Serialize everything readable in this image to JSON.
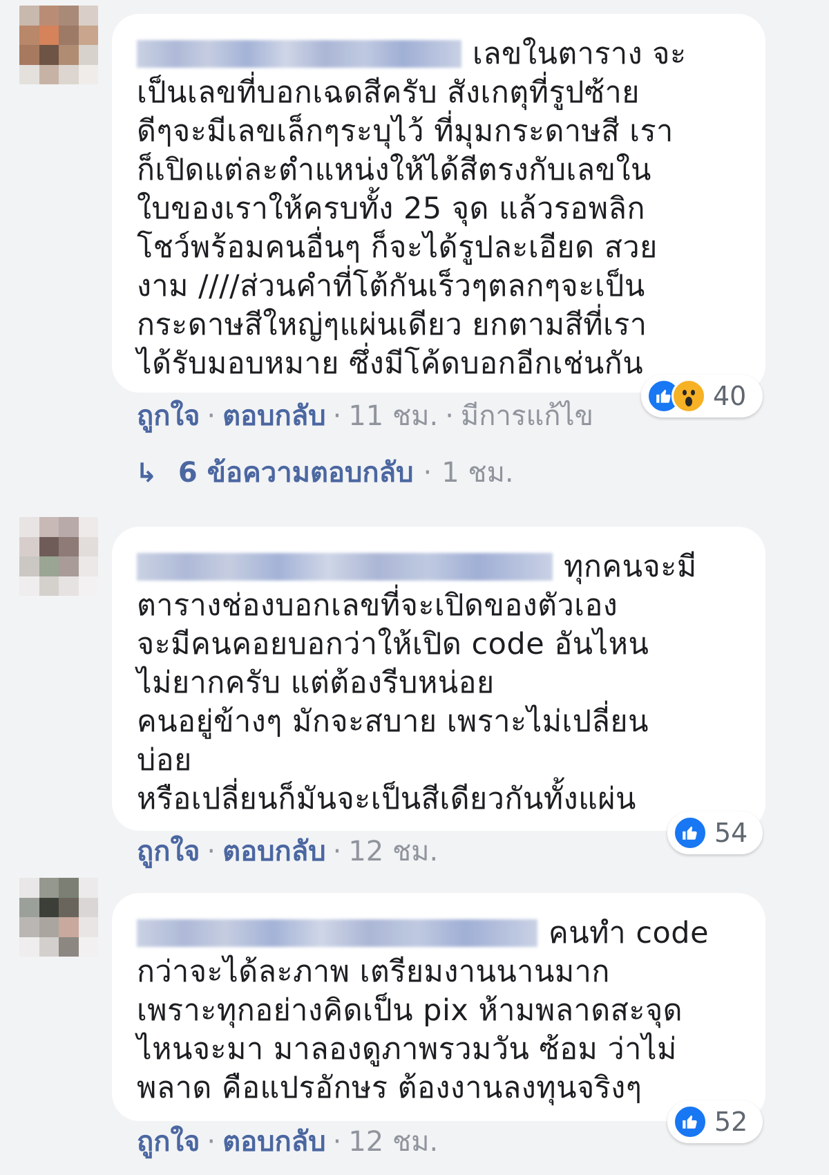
{
  "comments": [
    {
      "text_lines": [
        "เลขในตาราง จะ",
        "เป็นเลขที่บอกเฉดสีครับ สังเกตุที่รูปซ้าย",
        "ดีๆจะมีเลขเล็กๆระบุไว้ ที่มุมกระดาษสี เรา",
        "ก็เปิดแต่ละตำแหน่งให้ได้สีตรงกับเลขใน",
        "ใบของเราให้ครบทั้ง 25 จุด แล้วรอพลิก",
        "โชว์พร้อมคนอื่นๆ ก็จะได้รูปละเอียด สวย",
        "งาม ////ส่วนคำที่โต้กันเร็วๆตลกๆจะเป็น",
        "กระดาษสีใหญ่ๆแผ่นเดียว ยกตามสีที่เรา",
        "ได้รับมอบหมาย ซึ่งมีโค้ดบอกอีกเช่นกัน"
      ],
      "like_label": "ถูกใจ",
      "reply_label": "ตอบกลับ",
      "time": "11 ชม.",
      "edited_label": "มีการแก้ไข",
      "reaction_count": "40",
      "replies": {
        "count_label": "6 ข้อความตอบกลับ",
        "time": "1 ชม."
      }
    },
    {
      "text_lines": [
        "ทุกคนจะมี",
        "ตารางช่องบอกเลขที่จะเปิดของตัวเอง",
        "จะมีคนคอยบอกว่าให้เปิด code อันไหน",
        "ไม่ยากครับ แต่ต้องรีบหน่อย",
        "คนอยู่ข้างๆ มักจะสบาย เพราะไม่เปลี่ยน",
        "บ่อย",
        "หรือเปลี่ยนก็มันจะเป็นสีเดียวกันทั้งแผ่น"
      ],
      "like_label": "ถูกใจ",
      "reply_label": "ตอบกลับ",
      "time": "12 ชม.",
      "reaction_count": "54"
    },
    {
      "text_lines": [
        "คนทำ code",
        "กว่าจะได้ละภาพ เตรียมงานนานมาก",
        "เพราะทุกอย่างคิดเป็น pix ห้ามพลาดสะจุด",
        "ไหนจะมา มาลองดูภาพรวมวัน ซ้อม ว่าไม่",
        "พลาด คือแปรอักษร ต้องงานลงทุนจริงๆ"
      ],
      "like_label": "ถูกใจ",
      "reply_label": "ตอบกลับ",
      "time": "12 ชม.",
      "reaction_count": "52"
    }
  ],
  "separator": "·",
  "colors": {
    "background": "#f2f3f5",
    "bubble": "#ffffff",
    "link": "#4b67a1",
    "muted": "#90949c",
    "like_blue": "#1877f2",
    "wow_yellow": "#f7b125"
  }
}
